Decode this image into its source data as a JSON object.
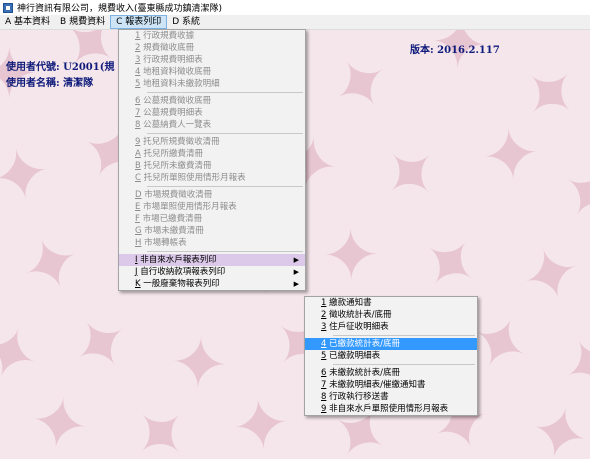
{
  "window": {
    "title": "神行資訊有限公司，規費收入(臺東縣成功鎮清潔隊)"
  },
  "menubar": [
    {
      "label": "A 基本資料"
    },
    {
      "label": "B 規費資料"
    },
    {
      "label": "C 報表列印"
    },
    {
      "label": "D 系統"
    }
  ],
  "info": {
    "version": "版本:   2016.2.117",
    "user_code": "使用者代號: U2001(規",
    "user_name": "使用者名稱: 清潔隊"
  },
  "report_menu": [
    {
      "key": "1",
      "text": " 行政規費收據",
      "disabled": true
    },
    {
      "key": "2",
      "text": " 規費徵收底冊",
      "disabled": true
    },
    {
      "key": "3",
      "text": " 行政規費明細表",
      "disabled": true
    },
    {
      "key": "4",
      "text": " 地租資料徵收底冊",
      "disabled": true
    },
    {
      "key": "5",
      "text": " 地租資料未繳款明細",
      "disabled": true
    },
    {
      "sep": true
    },
    {
      "key": "6",
      "text": " 公墓規費徵收底冊",
      "disabled": true
    },
    {
      "key": "7",
      "text": " 公墓規費明細表",
      "disabled": true
    },
    {
      "key": "8",
      "text": " 公墓納費人一覽表",
      "disabled": true
    },
    {
      "sep": true
    },
    {
      "key": "9",
      "text": " 托兒所規費徵收清冊",
      "disabled": true
    },
    {
      "key": "A",
      "text": " 托兒所繳費清冊",
      "disabled": true
    },
    {
      "key": "B",
      "text": " 托兒所未繳費清冊",
      "disabled": true
    },
    {
      "key": "C",
      "text": " 托兒所單照使用情形月報表",
      "disabled": true
    },
    {
      "sep": true
    },
    {
      "key": "D",
      "text": " 市場規費徵收清冊",
      "disabled": true
    },
    {
      "key": "E",
      "text": " 市場單照使用情形月報表",
      "disabled": true
    },
    {
      "key": "F",
      "text": " 市場已繳費清冊",
      "disabled": true
    },
    {
      "key": "G",
      "text": " 市場未繳費清冊",
      "disabled": true
    },
    {
      "key": "H",
      "text": " 市場轉帳表",
      "disabled": true
    },
    {
      "sep": true
    },
    {
      "key": "I",
      "text": " 非自來水戶報表列印",
      "disabled": false,
      "submenu": true,
      "state": "open"
    },
    {
      "key": "J",
      "text": " 自行收納款項報表列印",
      "disabled": false,
      "submenu": true
    },
    {
      "key": "K",
      "text": " 一般廢棄物報表列印",
      "disabled": false,
      "submenu": true
    }
  ],
  "sub_menu": [
    {
      "key": "1",
      "text": " 繳款通知書"
    },
    {
      "key": "2",
      "text": " 徵收統計表/底冊"
    },
    {
      "key": "3",
      "text": " 住戶征收明細表"
    },
    {
      "sep": true
    },
    {
      "key": "4",
      "text": " 已繳款統計表/底冊",
      "highlight": true
    },
    {
      "key": "5",
      "text": " 已繳款明細表"
    },
    {
      "sep": true
    },
    {
      "key": "6",
      "text": " 未繳款統計表/底冊"
    },
    {
      "key": "7",
      "text": " 未繳款明細表/催繳通知書"
    },
    {
      "key": "8",
      "text": " 行政執行移送書"
    },
    {
      "key": "9",
      "text": " 非自來水戶單照使用情形月報表"
    }
  ],
  "colors": {
    "accent": "#3399ff",
    "info_text": "#0e1a7a",
    "leaf": "#e8c6d1"
  }
}
